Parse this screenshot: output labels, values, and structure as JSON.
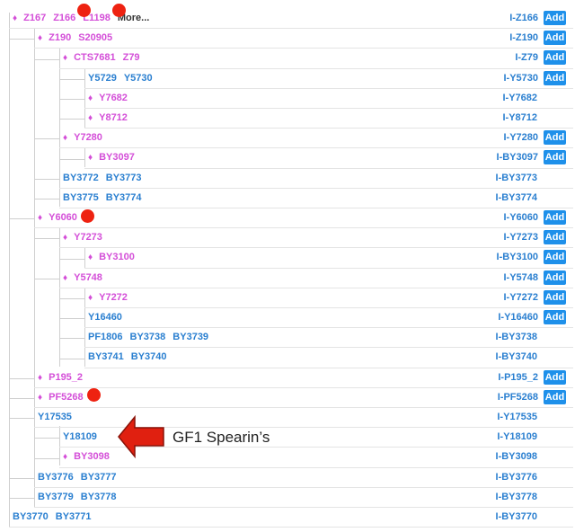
{
  "more_label": "More...",
  "add_label": "Add",
  "annotation": "GF1 Spearin’s",
  "colors": {
    "pink": "#d44fd8",
    "blue": "#2a7fd0",
    "add_button": "#1e90ea",
    "marker": "#ee2211",
    "arrow": "#e02010"
  },
  "rows": [
    {
      "snps": [
        "Z167",
        "Z166",
        "L1198"
      ],
      "diamond": true,
      "more": true,
      "id": "I-Z166",
      "add": true
    },
    {
      "snps": [
        "Z190",
        "S20905"
      ],
      "diamond": true,
      "id": "I-Z190",
      "add": true
    },
    {
      "snps": [
        "CTS7681",
        "Z79"
      ],
      "diamond": true,
      "id": "I-Z79",
      "add": true
    },
    {
      "snps": [
        "Y5729",
        "Y5730"
      ],
      "diamond": false,
      "id": "I-Y5730",
      "add": true
    },
    {
      "snps": [
        "Y7682"
      ],
      "diamond": true,
      "id": "I-Y7682",
      "add": false
    },
    {
      "snps": [
        "Y8712"
      ],
      "diamond": true,
      "id": "I-Y8712",
      "add": false
    },
    {
      "snps": [
        "Y7280"
      ],
      "diamond": true,
      "id": "I-Y7280",
      "add": true
    },
    {
      "snps": [
        "BY3097"
      ],
      "diamond": true,
      "id": "I-BY3097",
      "add": true
    },
    {
      "snps": [
        "BY3772",
        "BY3773"
      ],
      "diamond": false,
      "id": "I-BY3773",
      "add": false
    },
    {
      "snps": [
        "BY3775",
        "BY3774"
      ],
      "diamond": false,
      "id": "I-BY3774",
      "add": false
    },
    {
      "snps": [
        "Y6060"
      ],
      "diamond": true,
      "id": "I-Y6060",
      "add": true
    },
    {
      "snps": [
        "Y7273"
      ],
      "diamond": true,
      "id": "I-Y7273",
      "add": true
    },
    {
      "snps": [
        "BY3100"
      ],
      "diamond": true,
      "id": "I-BY3100",
      "add": true
    },
    {
      "snps": [
        "Y5748"
      ],
      "diamond": true,
      "id": "I-Y5748",
      "add": true
    },
    {
      "snps": [
        "Y7272"
      ],
      "diamond": true,
      "id": "I-Y7272",
      "add": true
    },
    {
      "snps": [
        "Y16460"
      ],
      "diamond": false,
      "id": "I-Y16460",
      "add": true
    },
    {
      "snps": [
        "PF1806",
        "BY3738",
        "BY3739"
      ],
      "diamond": false,
      "id": "I-BY3738",
      "add": false
    },
    {
      "snps": [
        "BY3741",
        "BY3740"
      ],
      "diamond": false,
      "id": "I-BY3740",
      "add": false
    },
    {
      "snps": [
        "P195_2"
      ],
      "diamond": true,
      "id": "I-P195_2",
      "add": true
    },
    {
      "snps": [
        "PF5268"
      ],
      "diamond": true,
      "id": "I-PF5268",
      "add": true
    },
    {
      "snps": [
        "Y17535"
      ],
      "diamond": false,
      "id": "I-Y17535",
      "add": false
    },
    {
      "snps": [
        "Y18109"
      ],
      "diamond": false,
      "id": "I-Y18109",
      "add": false
    },
    {
      "snps": [
        "BY3098"
      ],
      "diamond": true,
      "id": "I-BY3098",
      "add": false
    },
    {
      "snps": [
        "BY3776",
        "BY3777"
      ],
      "diamond": false,
      "id": "I-BY3776",
      "add": false
    },
    {
      "snps": [
        "BY3779",
        "BY3778"
      ],
      "diamond": false,
      "id": "I-BY3778",
      "add": false
    },
    {
      "snps": [
        "BY3770",
        "BY3771"
      ],
      "diamond": false,
      "id": "I-BY3770",
      "add": false
    }
  ]
}
